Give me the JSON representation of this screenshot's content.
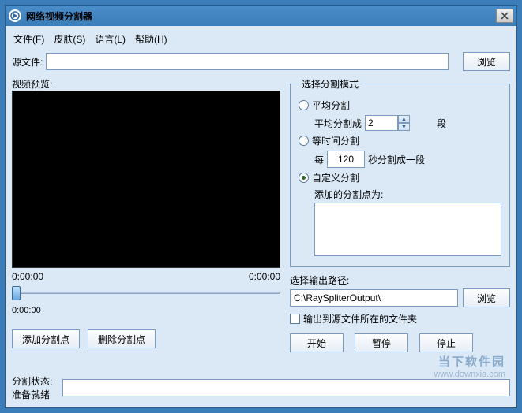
{
  "title": "网络视频分割器",
  "menu": {
    "file": "文件(F)",
    "skin": "皮肤(S)",
    "language": "语言(L)",
    "help": "帮助(H)"
  },
  "source": {
    "label": "源文件:",
    "value": "",
    "browse": "浏览"
  },
  "preview": {
    "label": "视频预览:",
    "time_left": "0:00:00",
    "time_right": "0:00:00",
    "pos": "0:00:00"
  },
  "split_btns": {
    "add": "添加分割点",
    "del": "删除分割点"
  },
  "mode": {
    "legend": "选择分割模式",
    "avg": {
      "label": "平均分割",
      "sub": "平均分割成",
      "value": "2",
      "unit": "段"
    },
    "time": {
      "label": "等时间分割",
      "sub": "每",
      "value": "120",
      "unit": "秒分割成一段"
    },
    "custom": {
      "label": "自定义分割",
      "sub": "添加的分割点为:",
      "value": ""
    },
    "selected": "custom"
  },
  "output": {
    "label": "选择输出路径:",
    "path": "C:\\RaySpliterOutput\\",
    "browse": "浏览",
    "same_folder": "输出到源文件所在的文件夹",
    "same_folder_checked": false
  },
  "actions": {
    "start": "开始",
    "pause": "暂停",
    "stop": "停止"
  },
  "status": {
    "label": "分割状态:",
    "ready": "准备就绪",
    "value": ""
  },
  "watermark": {
    "line1": "当下软件园",
    "line2": "www.downxia.com"
  }
}
